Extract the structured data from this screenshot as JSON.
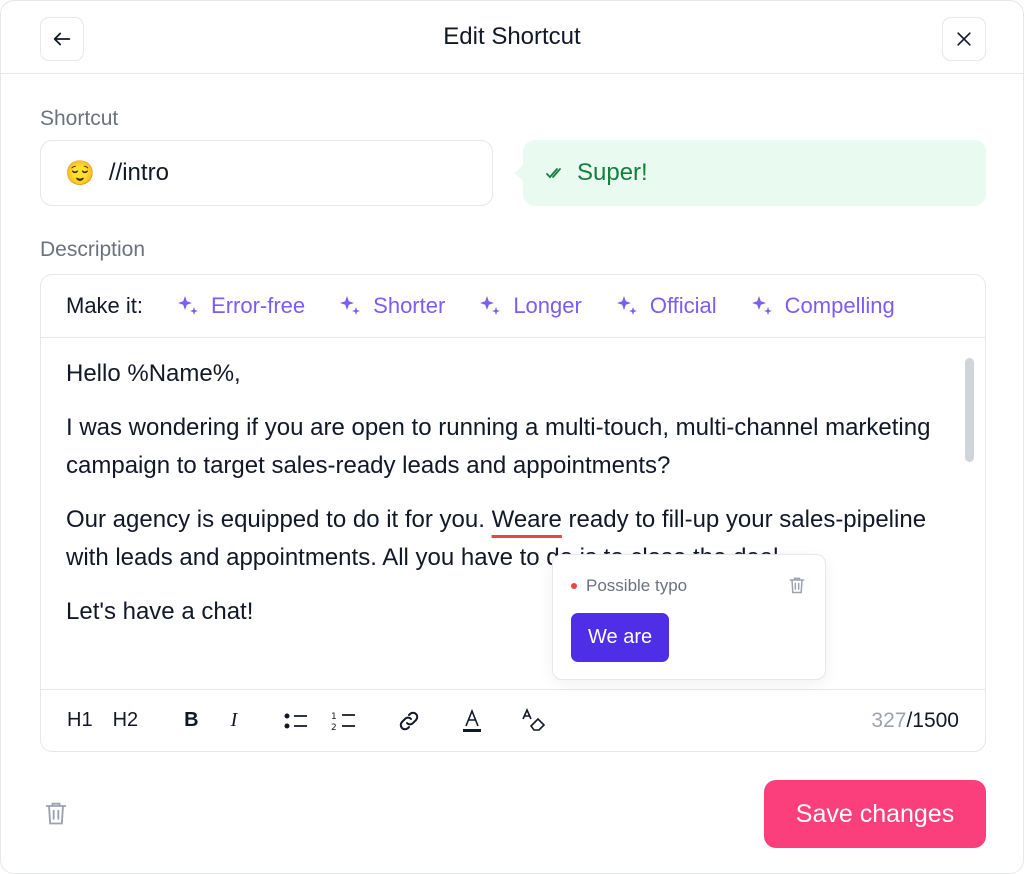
{
  "header": {
    "title": "Edit Shortcut",
    "back_icon": "arrow-left-icon",
    "close_icon": "close-icon"
  },
  "shortcut": {
    "label": "Shortcut",
    "emoji": "😌",
    "value": "//intro",
    "feedback": "Super!",
    "feedback_color": "#15803d"
  },
  "description": {
    "label": "Description",
    "make_it_label": "Make it:",
    "ai_options": [
      "Error-free",
      "Shorter",
      "Longer",
      "Official",
      "Compelling"
    ],
    "paragraphs": {
      "p1": "Hello %Name%,",
      "p2": "I was wondering if you are open to running a multi-touch, multi-channel marketing campaign to target sales-ready leads and appointments?",
      "p3_before": "Our agency is equipped to do it for you. ",
      "p3_typo": "Weare",
      "p3_after": " ready to fill-up your sales-pipeline with leads and appointments. All you have to do is to close the deal.",
      "p4": "Let's have a chat!"
    },
    "toolbar": {
      "h1": "H1",
      "h2": "H2",
      "bold": "B",
      "italic": "I"
    },
    "count_used": "327",
    "count_max": "/1500"
  },
  "typo_popup": {
    "title": "Possible typo",
    "suggestion": "We are"
  },
  "footer": {
    "save_label": "Save changes",
    "save_color": "#fb3f7c"
  },
  "accent_color": "#7c5cf6"
}
